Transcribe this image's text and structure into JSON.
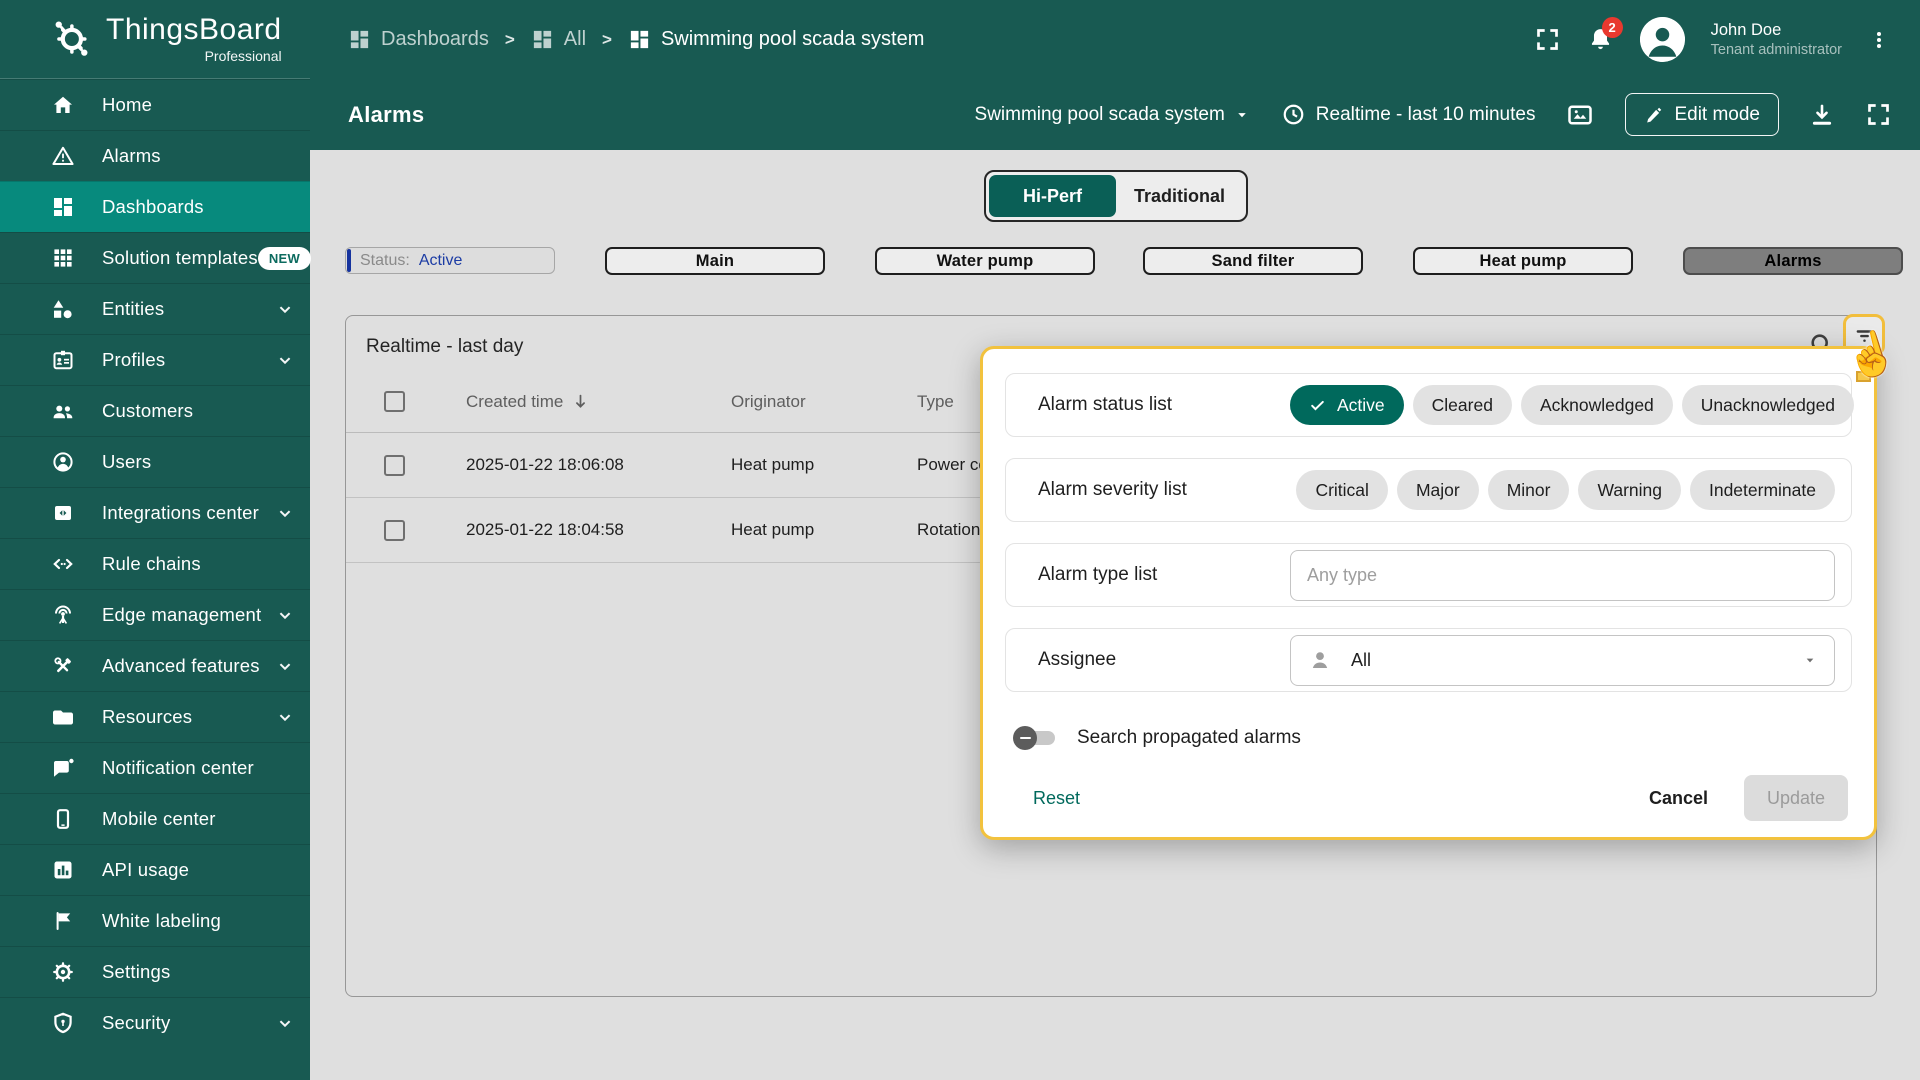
{
  "brand": {
    "name": "ThingsBoard",
    "edition": "Professional",
    "logo_icon": "thingsboard-gear-logo"
  },
  "sidebar": {
    "items": [
      {
        "label": "Home",
        "icon": "home-icon"
      },
      {
        "label": "Alarms",
        "icon": "warning-triangle-icon"
      },
      {
        "label": "Dashboards",
        "icon": "dashboards-icon",
        "selected": true
      },
      {
        "label": "Solution templates",
        "icon": "grid-icon",
        "badge": "NEW"
      },
      {
        "label": "Entities",
        "icon": "shapes-icon",
        "expandable": true
      },
      {
        "label": "Profiles",
        "icon": "id-badge-icon",
        "expandable": true
      },
      {
        "label": "Customers",
        "icon": "people-icon"
      },
      {
        "label": "Users",
        "icon": "person-circle-icon"
      },
      {
        "label": "Integrations center",
        "icon": "integration-icon",
        "expandable": true
      },
      {
        "label": "Rule chains",
        "icon": "code-brackets-icon"
      },
      {
        "label": "Edge management",
        "icon": "antenna-icon",
        "expandable": true
      },
      {
        "label": "Advanced features",
        "icon": "tools-icon",
        "expandable": true
      },
      {
        "label": "Resources",
        "icon": "folder-icon",
        "expandable": true
      },
      {
        "label": "Notification center",
        "icon": "chat-bubble-icon"
      },
      {
        "label": "Mobile center",
        "icon": "smartphone-icon"
      },
      {
        "label": "API usage",
        "icon": "bar-chart-icon"
      },
      {
        "label": "White labeling",
        "icon": "flag-icon"
      },
      {
        "label": "Settings",
        "icon": "gear-icon"
      },
      {
        "label": "Security",
        "icon": "shield-icon",
        "expandable": true
      }
    ]
  },
  "breadcrumb": {
    "separator": ">",
    "items": [
      "Dashboards",
      "All",
      "Swimming pool scada system"
    ]
  },
  "header": {
    "notifications_count": "2",
    "user": {
      "name": "John Doe",
      "role": "Tenant administrator"
    }
  },
  "toolbar": {
    "title": "Alarms",
    "entity": "Swimming pool scada system",
    "time_window": "Realtime - last 10 minutes",
    "edit_mode_label": "Edit mode"
  },
  "view_toggle": {
    "options": [
      "Hi-Perf",
      "Traditional"
    ],
    "selected": "Hi-Perf"
  },
  "state_bar": {
    "status_label": "Status:",
    "status_value": "Active",
    "tabs": [
      "Main",
      "Water pump",
      "Sand filter",
      "Heat pump",
      "Alarms"
    ],
    "selected_tab": "Alarms"
  },
  "alarm_table": {
    "title": "Realtime - last day",
    "columns": [
      "Created time",
      "Originator",
      "Type"
    ],
    "rows": [
      {
        "time": "2025-01-22 18:06:08",
        "originator": "Heat pump",
        "type": "Power co"
      },
      {
        "time": "2025-01-22 18:04:58",
        "originator": "Heat pump",
        "type": "Rotation"
      }
    ]
  },
  "filter_popup": {
    "status": {
      "label": "Alarm status list",
      "selected": "Active",
      "options": [
        "Active",
        "Cleared",
        "Acknowledged",
        "Unacknowledged"
      ]
    },
    "severity": {
      "label": "Alarm severity list",
      "options": [
        "Critical",
        "Major",
        "Minor",
        "Warning",
        "Indeterminate"
      ]
    },
    "type": {
      "label": "Alarm type list",
      "placeholder": "Any type"
    },
    "assignee": {
      "label": "Assignee",
      "value": "All"
    },
    "propagated": {
      "label": "Search propagated alarms",
      "enabled": false
    },
    "actions": {
      "reset": "Reset",
      "cancel": "Cancel",
      "update": "Update"
    }
  },
  "colors": {
    "teal_dark": "#185A52",
    "teal_selected": "#078A7D",
    "teal_primary": "#00695C",
    "hi_perf_teal": "#0A5F56",
    "gold_highlight": "#F2C23E",
    "status_blue": "#1C3CA4",
    "badge_red": "#E8392F",
    "page_bg": "#DFDFDF",
    "selected_tab_gray": "#7E7E7E"
  }
}
